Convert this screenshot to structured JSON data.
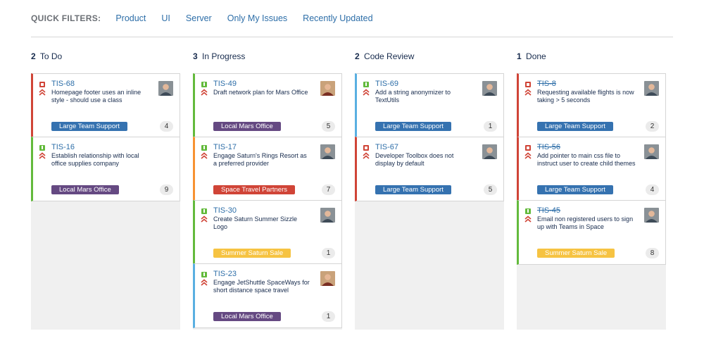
{
  "filters": {
    "label": "QUICK FILTERS:",
    "items": [
      "Product",
      "UI",
      "Server",
      "Only My Issues",
      "Recently Updated"
    ]
  },
  "colors": {
    "link": "#2d6ea8",
    "bug": "#d04437",
    "story": "#63ba3c",
    "epic_blue": "#3572b0",
    "epic_purple": "#654982",
    "epic_red": "#d04437",
    "epic_yellow": "#f6c342",
    "column_bg": "#f0f0f0"
  },
  "columns": [
    {
      "count": "2",
      "name": "To Do",
      "cards": [
        {
          "key": "TIS-68",
          "summary": "Homepage footer uses an inline style - should use a class",
          "type": "bug-icon",
          "epic": "Large Team Support",
          "points": "4"
        },
        {
          "key": "TIS-16",
          "summary": "Establish relationship with local office supplies company",
          "type": "story-icon",
          "epic": "Local Mars Office",
          "points": "9"
        }
      ]
    },
    {
      "count": "3",
      "name": "In Progress",
      "cards": [
        {
          "key": "TIS-49",
          "summary": "Draft network plan for Mars Office",
          "type": "story-icon",
          "epic": "Local Mars Office",
          "points": "5"
        },
        {
          "key": "TIS-17",
          "summary": "Engage Saturn's Rings Resort as a preferred provider",
          "type": "story-icon",
          "epic": "Space Travel Partners",
          "points": "7"
        },
        {
          "key": "TIS-30",
          "summary": "Create Saturn Summer Sizzle Logo",
          "type": "story-icon",
          "epic": "Summer Saturn Sale",
          "points": "1"
        },
        {
          "key": "TIS-23",
          "summary": "Engage JetShuttle SpaceWays for short distance space travel",
          "type": "story-icon",
          "epic": "Local Mars Office",
          "points": "1"
        }
      ]
    },
    {
      "count": "2",
      "name": "Code Review",
      "cards": [
        {
          "key": "TIS-69",
          "summary": "Add a string anonymizer to TextUtils",
          "type": "story-icon",
          "epic": "Large Team Support",
          "points": "1"
        },
        {
          "key": "TIS-67",
          "summary": "Developer Toolbox does not display by default",
          "type": "bug-icon",
          "epic": "Large Team Support",
          "points": "5"
        }
      ]
    },
    {
      "count": "1",
      "name": "Done",
      "cards": [
        {
          "key": "TIS-8",
          "summary": "Requesting available flights is now taking > 5 seconds",
          "type": "bug-icon",
          "epic": "Large Team Support",
          "points": "2"
        },
        {
          "key": "TIS-56",
          "summary": "Add pointer to main css file to instruct user to create child themes",
          "type": "bug-icon",
          "epic": "Large Team Support",
          "points": "4"
        },
        {
          "key": "TIS-45",
          "summary": "Email non registered users to sign up with Teams in Space",
          "type": "story-icon",
          "epic": "Summer Saturn Sale",
          "points": "8"
        }
      ]
    }
  ]
}
